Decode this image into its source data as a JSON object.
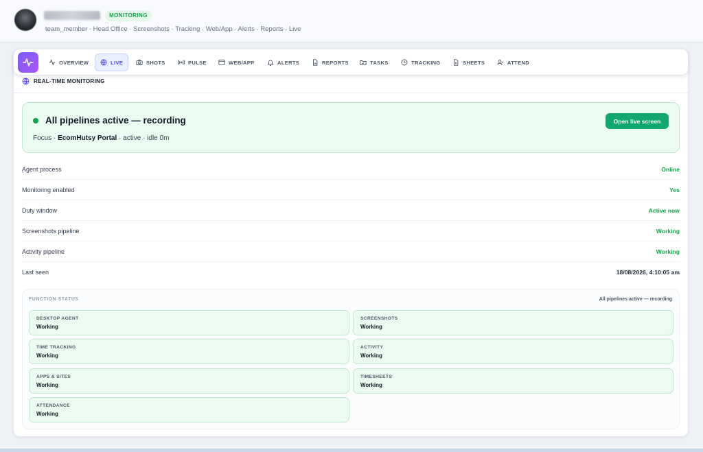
{
  "header": {
    "badge": "MONITORING",
    "breadcrumb": "team_member · Head Office · Screenshots · Tracking · Web/App · Alerts · Reports · Live"
  },
  "tabs": [
    {
      "label": "OVERVIEW",
      "icon": "activity-icon"
    },
    {
      "label": "LIVE",
      "icon": "globe-icon",
      "active": true
    },
    {
      "label": "SHOTS",
      "icon": "camera-icon"
    },
    {
      "label": "PULSE",
      "icon": "broadcast-icon"
    },
    {
      "label": "WEB/APP",
      "icon": "window-icon"
    },
    {
      "label": "ALERTS",
      "icon": "bell-icon"
    },
    {
      "label": "REPORTS",
      "icon": "file-chart-icon"
    },
    {
      "label": "TASKS",
      "icon": "folder-icon"
    },
    {
      "label": "TRACKING",
      "icon": "clock-icon"
    },
    {
      "label": "SHEETS",
      "icon": "sheet-icon"
    },
    {
      "label": "ATTEND",
      "icon": "user-check-icon"
    }
  ],
  "section": {
    "title": "REAL-TIME MONITORING"
  },
  "banner": {
    "title": "All pipelines active — recording",
    "focus_prefix": "Focus · ",
    "focus_app": "EcomHutsy Portal",
    "focus_suffix": " · active · idle 0m",
    "button": "Open live screen"
  },
  "status_rows": [
    {
      "label": "Agent process",
      "value": "Online"
    },
    {
      "label": "Monitoring enabled",
      "value": "Yes"
    },
    {
      "label": "Duty window",
      "value": "Active now"
    },
    {
      "label": "Screenshots pipeline",
      "value": "Working"
    },
    {
      "label": "Activity pipeline",
      "value": "Working"
    },
    {
      "label": "Last seen",
      "value": "18/08/2026, 4:10:05 am"
    }
  ],
  "function_status": {
    "title": "FUNCTION STATUS",
    "summary": "All pipelines active — recording",
    "items": [
      {
        "label": "DESKTOP AGENT",
        "status": "Working"
      },
      {
        "label": "SCREENSHOTS",
        "status": "Working"
      },
      {
        "label": "TIME TRACKING",
        "status": "Working"
      },
      {
        "label": "ACTIVITY",
        "status": "Working"
      },
      {
        "label": "APPS & SITES",
        "status": "Working"
      },
      {
        "label": "TIMESHEETS",
        "status": "Working"
      },
      {
        "label": "ATTENDANCE",
        "status": "Working"
      }
    ]
  },
  "colors": {
    "accent": "#4f46e5",
    "brand": "#8b5cf6",
    "success": "#16a34a",
    "button": "#10a870"
  }
}
